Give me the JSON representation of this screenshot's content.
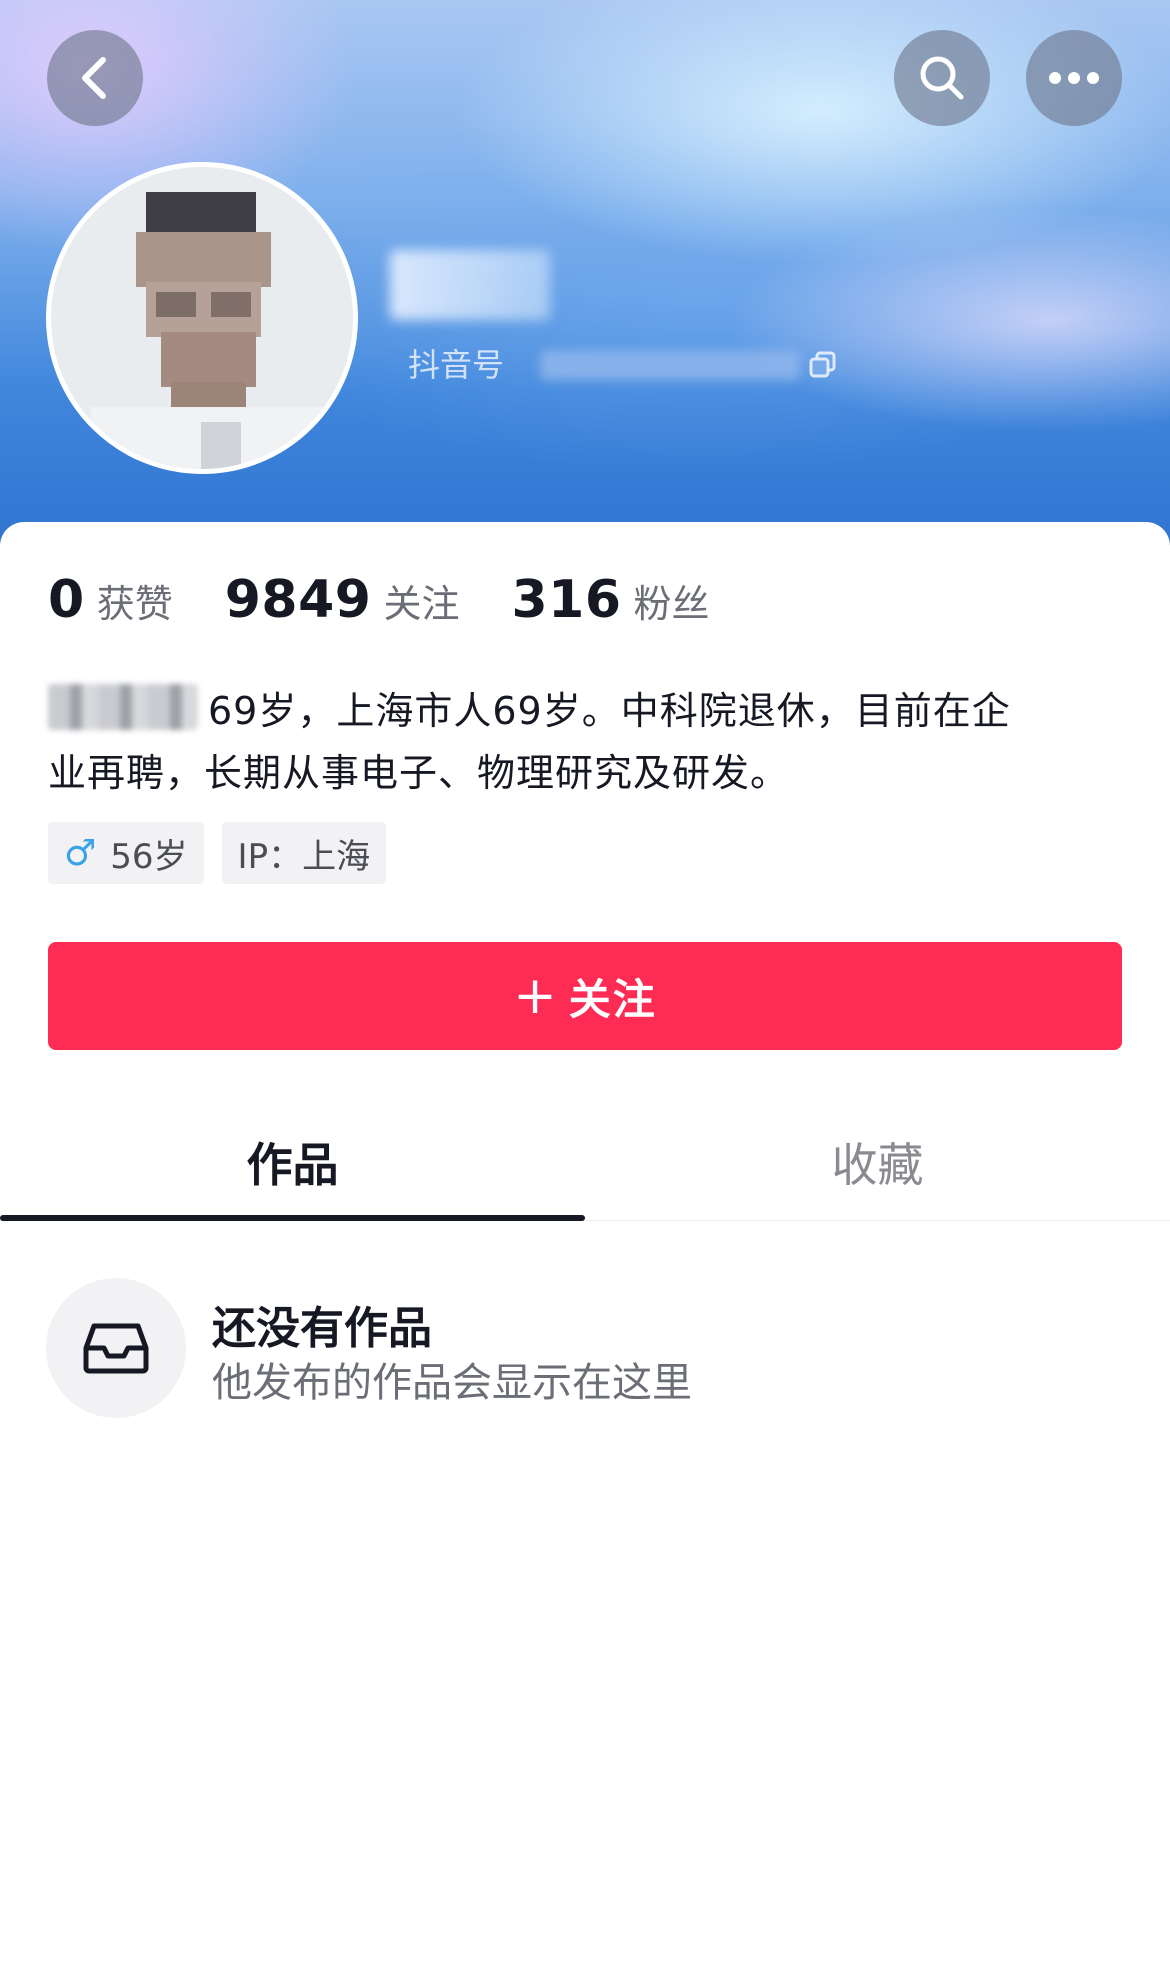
{
  "profile": {
    "douyin_id_label": "抖音号"
  },
  "stats": [
    {
      "value": "0",
      "label": "获赞"
    },
    {
      "value": "9849",
      "label": "关注"
    },
    {
      "value": "316",
      "label": "粉丝"
    }
  ],
  "bio": {
    "line1": "69岁，上海市人69岁。中科院退休，目前在企",
    "line2": "业再聘，长期从事电子、物理研究及研发。"
  },
  "tags": {
    "gender_icon": "♂",
    "age": "56岁",
    "ip": "IP：上海"
  },
  "follow_button": {
    "plus": "+",
    "label": "关注"
  },
  "tabs": [
    {
      "label": "作品",
      "active": true
    },
    {
      "label": "收藏",
      "active": false
    }
  ],
  "empty_state": {
    "icon": "inbox-icon",
    "title": "还没有作品",
    "subtitle": "他发布的作品会显示在这里"
  },
  "colors": {
    "accent": "#fe2c55",
    "banner": "#3f86dc"
  }
}
